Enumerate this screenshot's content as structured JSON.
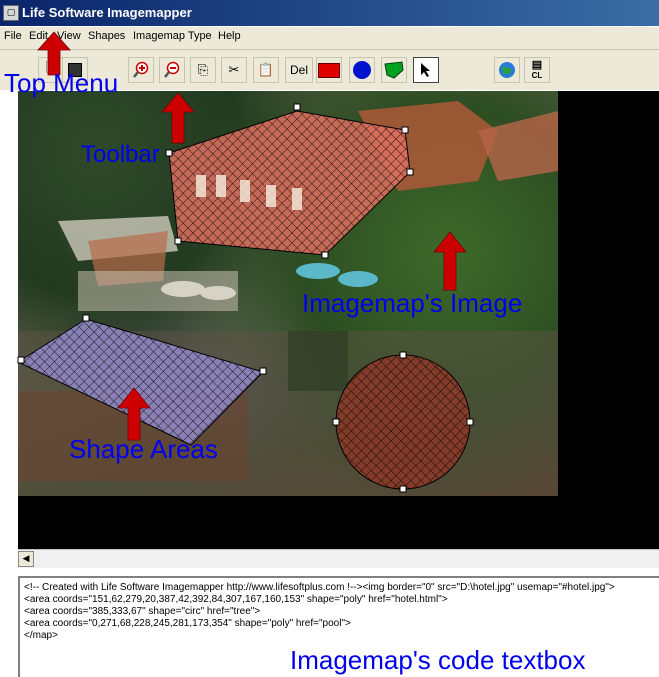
{
  "window": {
    "title": "Life Software Imagemapper"
  },
  "menu": [
    "File",
    "Edit",
    "View",
    "Shapes",
    "Imagemap Type",
    "Help"
  ],
  "toolbar": {
    "delete_label": "Del",
    "cl_label": "CL",
    "buttons": [
      "new-icon",
      "save-icon",
      "zoom-in-icon",
      "zoom-out-icon",
      "copy-icon",
      "cut-icon",
      "paste-icon",
      "delete",
      "rectangle-tool-icon",
      "circle-tool-icon",
      "polygon-tool-icon",
      "pointer-tool-icon",
      "web-globe-icon",
      "clear-list-icon"
    ],
    "selected": "pointer-tool-icon"
  },
  "annotations": {
    "top_menu": "Top Menu",
    "toolbar": "Toolbar",
    "image": "Imagemap's Image",
    "shapes": "Shape Areas",
    "code": "Imagemap's code textbox"
  },
  "code_lines": [
    "<!-- Created with Life Software Imagemapper http://www.lifesoftplus.com !--><img border=\"0\" src=\"D:\\hotel.jpg\" usemap=\"#hotel.jpg\">",
    "<area coords=\"151,62,279,20,387,42,392,84,307,167,160,153\" shape=\"poly\" href=\"hotel.html\">",
    "<area coords=\"385,333,67\" shape=\"circ\" href=\"tree\">",
    "<area coords=\"0,271,68,228,245,281,173,354\" shape=\"poly\" href=\"pool\">",
    "</map>"
  ],
  "colors": {
    "titlebar": "#0a246a",
    "annotation": "#0000ee",
    "arrow": "#cc0000",
    "menubar": "#ece9d8"
  }
}
